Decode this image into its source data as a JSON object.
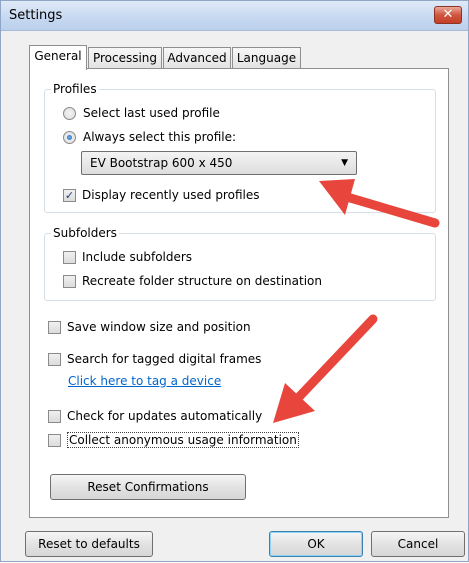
{
  "window": {
    "title": "Settings",
    "close_label": "✕"
  },
  "tabs": [
    {
      "label": "General",
      "active": true
    },
    {
      "label": "Processing",
      "active": false
    },
    {
      "label": "Advanced",
      "active": false
    },
    {
      "label": "Language",
      "active": false
    }
  ],
  "profiles": {
    "legend": "Profiles",
    "radio_last_used": "Select last used profile",
    "radio_always": "Always select this profile:",
    "selected_profile": "EV Bootstrap 600 x 450",
    "display_recent": "Display recently used profiles",
    "display_recent_checked": true
  },
  "subfolders": {
    "legend": "Subfolders",
    "include": "Include subfolders",
    "recreate": "Recreate folder structure on destination"
  },
  "options": {
    "save_window": "Save window size and position",
    "search_tagged": "Search for tagged digital frames",
    "tag_link": "Click here to tag a device",
    "check_updates": "Check for updates automatically",
    "collect_usage": "Collect anonymous usage information"
  },
  "buttons": {
    "reset_confirmations": "Reset Confirmations",
    "reset_defaults": "Reset to defaults",
    "ok": "OK",
    "cancel": "Cancel"
  },
  "annotation_color": "#e8453c"
}
